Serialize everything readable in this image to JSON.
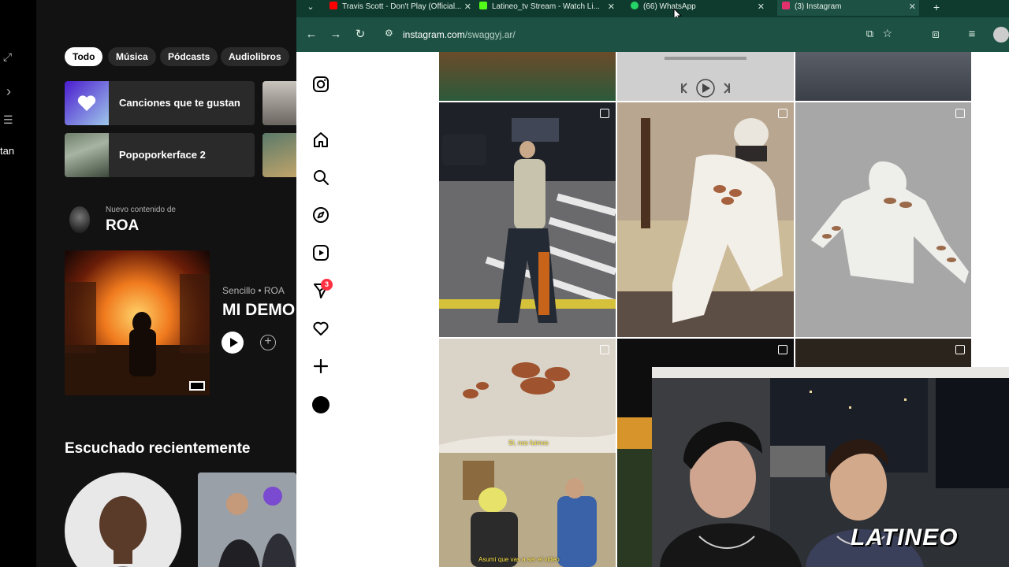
{
  "spotify": {
    "rail_text": "tan",
    "chips": [
      "Todo",
      "Música",
      "Pódcasts",
      "Audiolibros"
    ],
    "tiles": [
      {
        "label": "Canciones que te gustan"
      },
      {
        "label": "Popoporkerface 2"
      }
    ],
    "new_content": {
      "kicker": "Nuevo contenido de",
      "artist": "ROA"
    },
    "release": {
      "kicker": "Sencillo • ROA",
      "title": "MI DEMO"
    },
    "recent_title": "Escuchado recientemente"
  },
  "browser": {
    "tabs": [
      {
        "title": "Travis Scott - Don't Play (Official...",
        "favicon_color": "#ff0000"
      },
      {
        "title": "Latineo_tv Stream - Watch Li...",
        "favicon_color": "#53fc18"
      },
      {
        "title": "(66) WhatsApp",
        "favicon_color": "#25d366"
      },
      {
        "title": "(3) Instagram",
        "favicon_color": "#e1306c"
      }
    ],
    "url_host": "instagram.com",
    "url_path": "/swaggyj.ar/"
  },
  "instagram": {
    "notifications_badge": "3",
    "video_caption_1": "Sí, nos fuimos",
    "video_caption_2": "Asumí que vas a ser el video"
  },
  "overlay": {
    "logo": "LATINEO"
  }
}
